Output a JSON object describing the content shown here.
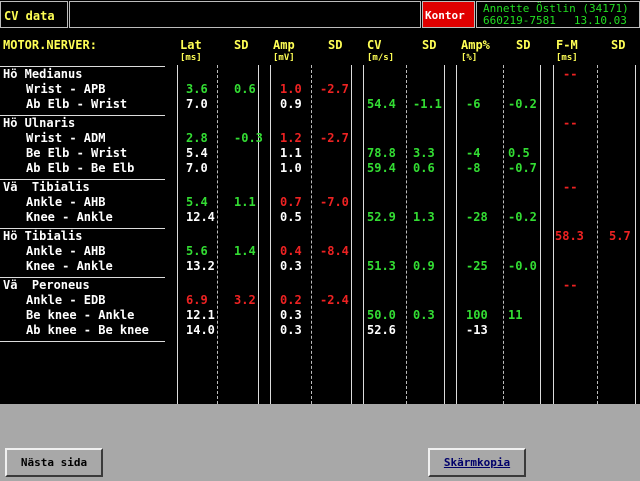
{
  "title": "CV data",
  "kontor_label": "Kontor",
  "patient": {
    "name": "Annette Östlin (34171)",
    "id": "660219-7581",
    "date": "13.10.03"
  },
  "header": {
    "section": "MOTOR.NERVER:",
    "lat": "Lat",
    "lat_unit": "[ms]",
    "lat_sd": "SD",
    "amp": "Amp",
    "amp_unit": "[mV]",
    "amp_sd": "SD",
    "cv": "CV",
    "cv_unit": "[m/s]",
    "cv_sd": "SD",
    "ampp": "Amp%",
    "ampp_unit": "[%]",
    "ampp_sd": "SD",
    "fm": "F-M",
    "fm_unit": "[ms]",
    "fm_sd": "SD"
  },
  "nerves": [
    {
      "name": "Hö Medianus",
      "fm": "--",
      "fm_sd": "",
      "fm_color": "r",
      "fm_sd_color": "r",
      "rows": [
        {
          "label": "Wrist - APB",
          "lat": "3.6",
          "lat_c": "g",
          "lat_sd": "0.6",
          "lat_sd_c": "g",
          "amp": "1.0",
          "amp_c": "r",
          "amp_sd": "-2.7",
          "amp_sd_c": "r",
          "cv": "",
          "cv_c": "g",
          "cv_sd": "",
          "cv_sd_c": "g",
          "ampp": "",
          "ampp_c": "g",
          "ampp_sd": "",
          "ampp_sd_c": "g"
        },
        {
          "label": "Ab Elb - Wrist",
          "lat": "7.0",
          "lat_c": "w",
          "lat_sd": "",
          "lat_sd_c": "g",
          "amp": "0.9",
          "amp_c": "w",
          "amp_sd": "",
          "amp_sd_c": "r",
          "cv": "54.4",
          "cv_c": "g",
          "cv_sd": "-1.1",
          "cv_sd_c": "g",
          "ampp": "-6",
          "ampp_c": "g",
          "ampp_sd": "-0.2",
          "ampp_sd_c": "g"
        }
      ]
    },
    {
      "name": "Hö Ulnaris",
      "fm": "--",
      "fm_sd": "",
      "fm_color": "r",
      "fm_sd_color": "r",
      "rows": [
        {
          "label": "Wrist - ADM",
          "lat": "2.8",
          "lat_c": "g",
          "lat_sd": "-0.3",
          "lat_sd_c": "g",
          "amp": "1.2",
          "amp_c": "r",
          "amp_sd": "-2.7",
          "amp_sd_c": "r",
          "cv": "",
          "cv_c": "g",
          "cv_sd": "",
          "cv_sd_c": "g",
          "ampp": "",
          "ampp_c": "g",
          "ampp_sd": "",
          "ampp_sd_c": "g"
        },
        {
          "label": "Be Elb - Wrist",
          "lat": "5.4",
          "lat_c": "w",
          "lat_sd": "",
          "lat_sd_c": "g",
          "amp": "1.1",
          "amp_c": "w",
          "amp_sd": "",
          "amp_sd_c": "r",
          "cv": "78.8",
          "cv_c": "g",
          "cv_sd": "3.3",
          "cv_sd_c": "g",
          "ampp": "-4",
          "ampp_c": "g",
          "ampp_sd": "0.5",
          "ampp_sd_c": "g"
        },
        {
          "label": "Ab Elb - Be Elb",
          "lat": "7.0",
          "lat_c": "w",
          "lat_sd": "",
          "lat_sd_c": "g",
          "amp": "1.0",
          "amp_c": "w",
          "amp_sd": "",
          "amp_sd_c": "r",
          "cv": "59.4",
          "cv_c": "g",
          "cv_sd": "0.6",
          "cv_sd_c": "g",
          "ampp": "-8",
          "ampp_c": "g",
          "ampp_sd": "-0.7",
          "ampp_sd_c": "g"
        }
      ]
    },
    {
      "name": "Vä  Tibialis",
      "fm": "--",
      "fm_sd": "",
      "fm_color": "r",
      "fm_sd_color": "r",
      "rows": [
        {
          "label": "Ankle - AHB",
          "lat": "5.4",
          "lat_c": "g",
          "lat_sd": "1.1",
          "lat_sd_c": "g",
          "amp": "0.7",
          "amp_c": "r",
          "amp_sd": "-7.0",
          "amp_sd_c": "r",
          "cv": "",
          "cv_c": "g",
          "cv_sd": "",
          "cv_sd_c": "g",
          "ampp": "",
          "ampp_c": "g",
          "ampp_sd": "",
          "ampp_sd_c": "g"
        },
        {
          "label": "Knee - Ankle",
          "lat": "12.4",
          "lat_c": "w",
          "lat_sd": "",
          "lat_sd_c": "g",
          "amp": "0.5",
          "amp_c": "w",
          "amp_sd": "",
          "amp_sd_c": "r",
          "cv": "52.9",
          "cv_c": "g",
          "cv_sd": "1.3",
          "cv_sd_c": "g",
          "ampp": "-28",
          "ampp_c": "g",
          "ampp_sd": "-0.2",
          "ampp_sd_c": "g"
        }
      ]
    },
    {
      "name": "Hö Tibialis",
      "fm": "58.3",
      "fm_sd": "5.7",
      "fm_color": "r",
      "fm_sd_color": "r",
      "rows": [
        {
          "label": "Ankle - AHB",
          "lat": "5.6",
          "lat_c": "g",
          "lat_sd": "1.4",
          "lat_sd_c": "g",
          "amp": "0.4",
          "amp_c": "r",
          "amp_sd": "-8.4",
          "amp_sd_c": "r",
          "cv": "",
          "cv_c": "g",
          "cv_sd": "",
          "cv_sd_c": "g",
          "ampp": "",
          "ampp_c": "g",
          "ampp_sd": "",
          "ampp_sd_c": "g"
        },
        {
          "label": "Knee - Ankle",
          "lat": "13.2",
          "lat_c": "w",
          "lat_sd": "",
          "lat_sd_c": "g",
          "amp": "0.3",
          "amp_c": "w",
          "amp_sd": "",
          "amp_sd_c": "r",
          "cv": "51.3",
          "cv_c": "g",
          "cv_sd": "0.9",
          "cv_sd_c": "g",
          "ampp": "-25",
          "ampp_c": "g",
          "ampp_sd": "-0.0",
          "ampp_sd_c": "g"
        }
      ]
    },
    {
      "name": "Vä  Peroneus",
      "fm": "--",
      "fm_sd": "",
      "fm_color": "r",
      "fm_sd_color": "r",
      "rows": [
        {
          "label": "Ankle - EDB",
          "lat": "6.9",
          "lat_c": "r",
          "lat_sd": "3.2",
          "lat_sd_c": "r",
          "amp": "0.2",
          "amp_c": "r",
          "amp_sd": "-2.4",
          "amp_sd_c": "r",
          "cv": "",
          "cv_c": "g",
          "cv_sd": "",
          "cv_sd_c": "g",
          "ampp": "",
          "ampp_c": "g",
          "ampp_sd": "",
          "ampp_sd_c": "g"
        },
        {
          "label": "Be knee - Ankle",
          "lat": "12.1",
          "lat_c": "w",
          "lat_sd": "",
          "lat_sd_c": "g",
          "amp": "0.3",
          "amp_c": "w",
          "amp_sd": "",
          "amp_sd_c": "r",
          "cv": "50.0",
          "cv_c": "g",
          "cv_sd": "0.3",
          "cv_sd_c": "g",
          "ampp": "100",
          "ampp_c": "g",
          "ampp_sd": "11",
          "ampp_sd_c": "g"
        },
        {
          "label": "Ab knee - Be knee",
          "lat": "14.0",
          "lat_c": "w",
          "lat_sd": "",
          "lat_sd_c": "g",
          "amp": "0.3",
          "amp_c": "w",
          "amp_sd": "",
          "amp_sd_c": "r",
          "cv": "52.6",
          "cv_c": "w",
          "cv_sd": "",
          "cv_sd_c": "g",
          "ampp": "-13",
          "ampp_c": "w",
          "ampp_sd": "",
          "ampp_sd_c": "g"
        }
      ]
    }
  ],
  "buttons": {
    "next_page": "Nästa sida",
    "screenshot": "Skärmkopia"
  }
}
